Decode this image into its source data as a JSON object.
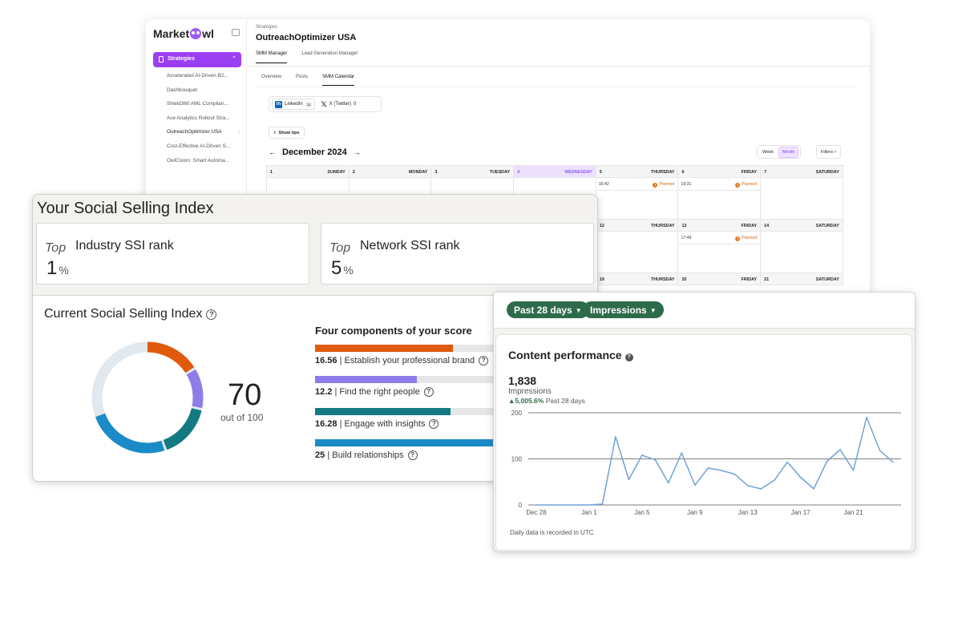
{
  "marketowl": {
    "logo_pre": "Market",
    "logo_post": "wl",
    "sidebar": {
      "strategies_label": "Strategies",
      "items": [
        "Accelerated AI-Driven B2...",
        "Dashbouquet",
        "Shield360 AML Complian...",
        "Ace Analytics Rollout Stra...",
        "OutreachOptimizer USA",
        "Cost-Effective AI-Driven S...",
        "OwlCision: Smart Automa..."
      ]
    },
    "breadcrumb": "Strategies",
    "title": "OutreachOptimizer USA",
    "tabs": [
      "SMM Manager",
      "Lead Generation Manager"
    ],
    "subtabs": [
      "Overview",
      "Posts",
      "SMM Calendar"
    ],
    "networks": [
      {
        "label": "LinkedIn",
        "count": "11",
        "icon": "linkedin-icon"
      },
      {
        "label": "X (Twitter)",
        "count": "0",
        "icon": "x-icon"
      }
    ],
    "show_tips": "Show tips",
    "month": "December 2024",
    "view_week": "Week",
    "view_month": "Month",
    "filters": "Filters",
    "calendar": {
      "week1": [
        {
          "d": "1",
          "w": "SUNDAY"
        },
        {
          "d": "2",
          "w": "MONDAY"
        },
        {
          "d": "3",
          "w": "TUESDAY"
        },
        {
          "d": "4",
          "w": "WEDNESDAY"
        },
        {
          "d": "5",
          "w": "THURSDAY"
        },
        {
          "d": "6",
          "w": "FRIDAY"
        },
        {
          "d": "7",
          "w": "SATURDAY"
        }
      ],
      "week2": [
        {
          "d": "12",
          "w": "THURSDAY"
        },
        {
          "d": "13",
          "w": "FRIDAY"
        },
        {
          "d": "14",
          "w": "SATURDAY"
        }
      ],
      "week3": [
        {
          "d": "19",
          "w": "THURSDAY"
        },
        {
          "d": "20",
          "w": "FRIDAY"
        },
        {
          "d": "21",
          "w": "SATURDAY"
        }
      ],
      "events": [
        {
          "time": "16:42",
          "status": "Planned"
        },
        {
          "time": "19:31",
          "status": "Planned"
        },
        {
          "time": "17:49",
          "status": "Planned"
        }
      ]
    }
  },
  "ssi": {
    "title": "Your Social Selling Index",
    "top_word": "Top",
    "industry_label": "Industry SSI rank",
    "industry_value": "1",
    "network_label": "Network SSI rank",
    "network_value": "5",
    "percent": "%",
    "current_title": "Current Social Selling Index",
    "score": "70",
    "score_sub": "out of 100",
    "components_title": "Four components of your score",
    "components": [
      {
        "value": "16.56",
        "label": "| Establish your professional brand",
        "fraction": 0.66,
        "color": "#e05a0b"
      },
      {
        "value": "12.2",
        "label": "| Find the right people",
        "fraction": 0.49,
        "color": "#8f7ce8"
      },
      {
        "value": "16.28",
        "label": "| Engage with insights",
        "fraction": 0.65,
        "color": "#137a84"
      },
      {
        "value": "25",
        "label": "| Build relationships",
        "fraction": 1.0,
        "color": "#1a8bc7"
      }
    ]
  },
  "performance": {
    "filter_period": "Past 28 days",
    "filter_metric": "Impressions",
    "title": "Content performance",
    "total": "1,838",
    "total_label": "Impressions",
    "delta": "5,005.6%",
    "delta_period": "Past 28 days",
    "footnote": "Daily data is recorded in UTC"
  },
  "chart_data": {
    "type": "line",
    "title": "Content performance",
    "ylabel": "",
    "xlabel": "",
    "ylim": [
      0,
      200
    ],
    "yticks": [
      0,
      100,
      200
    ],
    "xticks": [
      "Dec 28",
      "Jan 1",
      "Jan 5",
      "Jan 9",
      "Jan 13",
      "Jan 17",
      "Jan 21"
    ],
    "x": [
      "Dec 28",
      "Dec 29",
      "Dec 30",
      "Dec 31",
      "Jan 1",
      "Jan 2",
      "Jan 3",
      "Jan 4",
      "Jan 5",
      "Jan 6",
      "Jan 7",
      "Jan 8",
      "Jan 9",
      "Jan 10",
      "Jan 11",
      "Jan 12",
      "Jan 13",
      "Jan 14",
      "Jan 15",
      "Jan 16",
      "Jan 17",
      "Jan 18",
      "Jan 19",
      "Jan 20",
      "Jan 21",
      "Jan 22",
      "Jan 23",
      "Jan 24"
    ],
    "series": [
      {
        "values": [
          0,
          0,
          0,
          0,
          0,
          2,
          148,
          55,
          108,
          98,
          48,
          113,
          43,
          80,
          75,
          67,
          42,
          35,
          53,
          93,
          60,
          35,
          95,
          120,
          75,
          190,
          118,
          93
        ],
        "color": "#6fa3d6"
      }
    ]
  }
}
